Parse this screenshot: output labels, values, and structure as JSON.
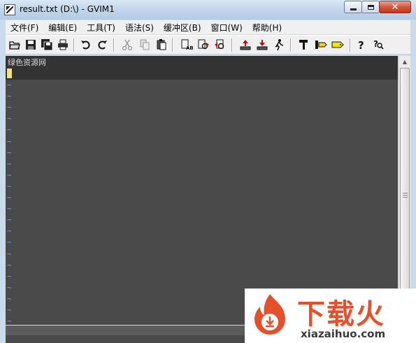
{
  "window": {
    "title": "result.txt (D:\\) - GVIM1",
    "close_label": "✕"
  },
  "menu": [
    {
      "label": "文件(F)"
    },
    {
      "label": "编辑(E)"
    },
    {
      "label": "工具(T)"
    },
    {
      "label": "语法(S)"
    },
    {
      "label": "缓冲区(B)"
    },
    {
      "label": "窗口(W)"
    },
    {
      "label": "帮助(H)"
    }
  ],
  "toolbar": {
    "icons": [
      "open-icon",
      "save-icon",
      "save-all-icon",
      "print-icon",
      "undo-icon",
      "redo-icon",
      "cut-icon",
      "copy-icon",
      "paste-icon",
      "find-replace-icon",
      "find-next-icon",
      "find-prev-icon",
      "load-session-icon",
      "save-session-icon",
      "run-script-icon",
      "make-icon",
      "run-ctags-icon",
      "jump-tag-icon",
      "help-icon",
      "find-help-icon"
    ]
  },
  "editor": {
    "lines": [
      "绿色资源网"
    ],
    "tilde": "~",
    "colors": {
      "background": "#4a4a4a",
      "cursorline": "#333333",
      "tilde": "#6f9fd8",
      "cursor": "#f0e08c"
    }
  },
  "watermark": {
    "main": "下载火",
    "site": "xiazaihuo.com"
  }
}
